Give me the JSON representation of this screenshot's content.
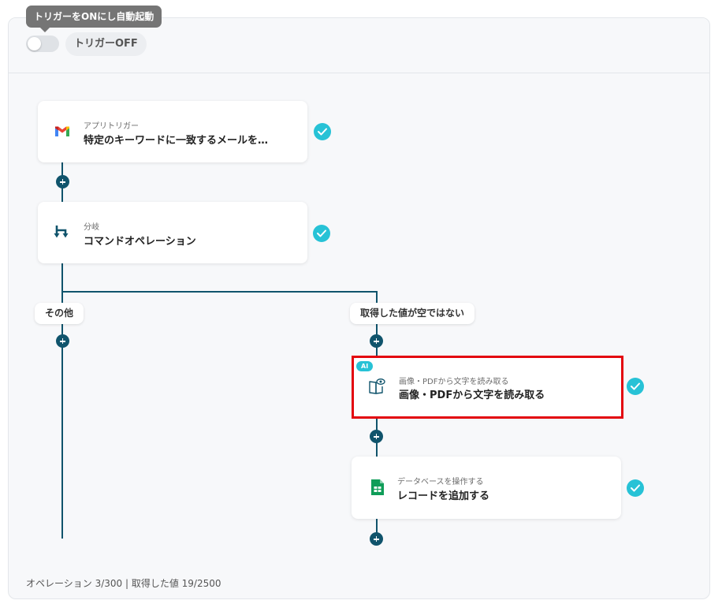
{
  "header": {
    "tooltip": "トリガーをONにし自動起動",
    "toggle_label": "トリガーOFF"
  },
  "flow": {
    "trigger": {
      "sub": "アプリトリガー",
      "title": "特定のキーワードに一致するメールを…",
      "icon": "gmail-icon"
    },
    "branch": {
      "sub": "分岐",
      "title": "コマンドオペレーション",
      "icon": "branch-icon"
    },
    "branch_labels": {
      "left": "その他",
      "right": "取得した値が空ではない"
    },
    "ocr": {
      "badge": "AI",
      "sub": "画像・PDFから文字を読み取る",
      "title": "画像・PDFから文字を読み取る",
      "icon": "book-ocr-icon"
    },
    "sheet": {
      "sub": "データベースを操作する",
      "title": "レコードを追加する",
      "icon": "google-sheets-icon"
    }
  },
  "footer": {
    "text": "オペレーション 3/300 | 取得した値 19/2500"
  },
  "colors": {
    "accent": "#10546c",
    "check": "#27c2d6",
    "highlight": "#e3060f"
  }
}
